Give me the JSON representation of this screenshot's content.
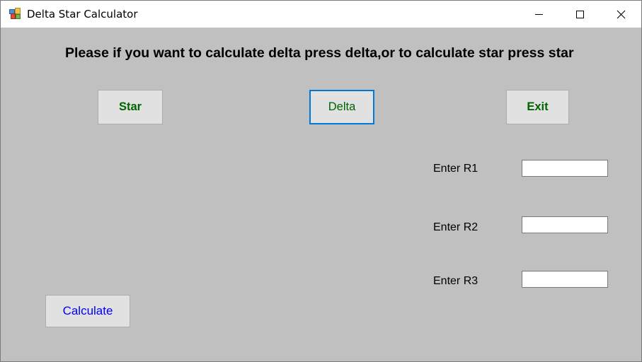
{
  "window": {
    "title": "Delta Star Calculator",
    "icon": "form-icon",
    "controls": {
      "minimize": "minimize-icon",
      "maximize": "maximize-icon",
      "close": "close-icon"
    }
  },
  "main": {
    "instruction": "Please if you want to calculate delta press delta,or to calculate star press star",
    "buttons": {
      "star": "Star",
      "delta": "Delta",
      "exit": "Exit",
      "calculate": "Calculate"
    },
    "fields": [
      {
        "label": "Enter R1",
        "value": ""
      },
      {
        "label": "Enter R2",
        "value": ""
      },
      {
        "label": "Enter R3",
        "value": ""
      }
    ]
  },
  "colors": {
    "background": "#c0c0c0",
    "button_face": "#e1e1e1",
    "button_text_green": "#006400",
    "calculate_text_blue": "#0000ff",
    "focus_border": "#0078d7"
  }
}
